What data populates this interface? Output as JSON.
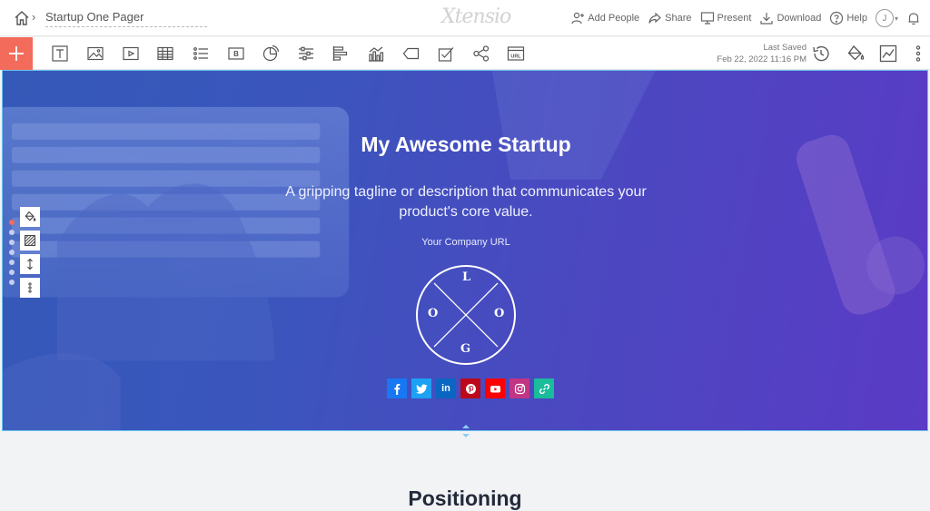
{
  "header": {
    "breadcrumb_chevron": "›",
    "doc_title": "Startup One Pager",
    "brand": "Xtensio",
    "actions": [
      {
        "label": "Add People"
      },
      {
        "label": "Share"
      },
      {
        "label": "Present"
      },
      {
        "label": "Download"
      },
      {
        "label": "Help"
      }
    ],
    "avatar_initial": "J"
  },
  "toolbar": {
    "tools": [
      "text",
      "image",
      "video",
      "table",
      "list",
      "button",
      "pie-chart",
      "sliders",
      "bar-chart-horizontal",
      "column-chart",
      "tag",
      "checklist",
      "network",
      "url"
    ],
    "last_saved_label": "Last Saved",
    "last_saved_time": "Feb 22, 2022 11:16 PM",
    "url_icon_text": "URL",
    "button_icon_text": "B"
  },
  "hero": {
    "title": "My Awesome Startup",
    "tagline": "A gripping tagline or description that communicates your product's core value.",
    "company_url": "Your Company URL",
    "logo_letters": {
      "top": "L",
      "left": "O",
      "right": "O",
      "bottom": "G"
    },
    "socials": [
      {
        "name": "facebook",
        "color": "#1877f2"
      },
      {
        "name": "twitter",
        "color": "#1da1f2"
      },
      {
        "name": "linkedin",
        "color": "#0a66c2"
      },
      {
        "name": "pinterest",
        "color": "#bd081c"
      },
      {
        "name": "youtube",
        "color": "#ff0000"
      },
      {
        "name": "instagram",
        "color": "#c13584"
      },
      {
        "name": "link",
        "color": "#1abc9c"
      }
    ],
    "linkedin_text": "in"
  },
  "next_section": {
    "title": "Positioning"
  },
  "colors": {
    "accent": "#f26b5b",
    "hero_border": "#6cc4f0"
  }
}
